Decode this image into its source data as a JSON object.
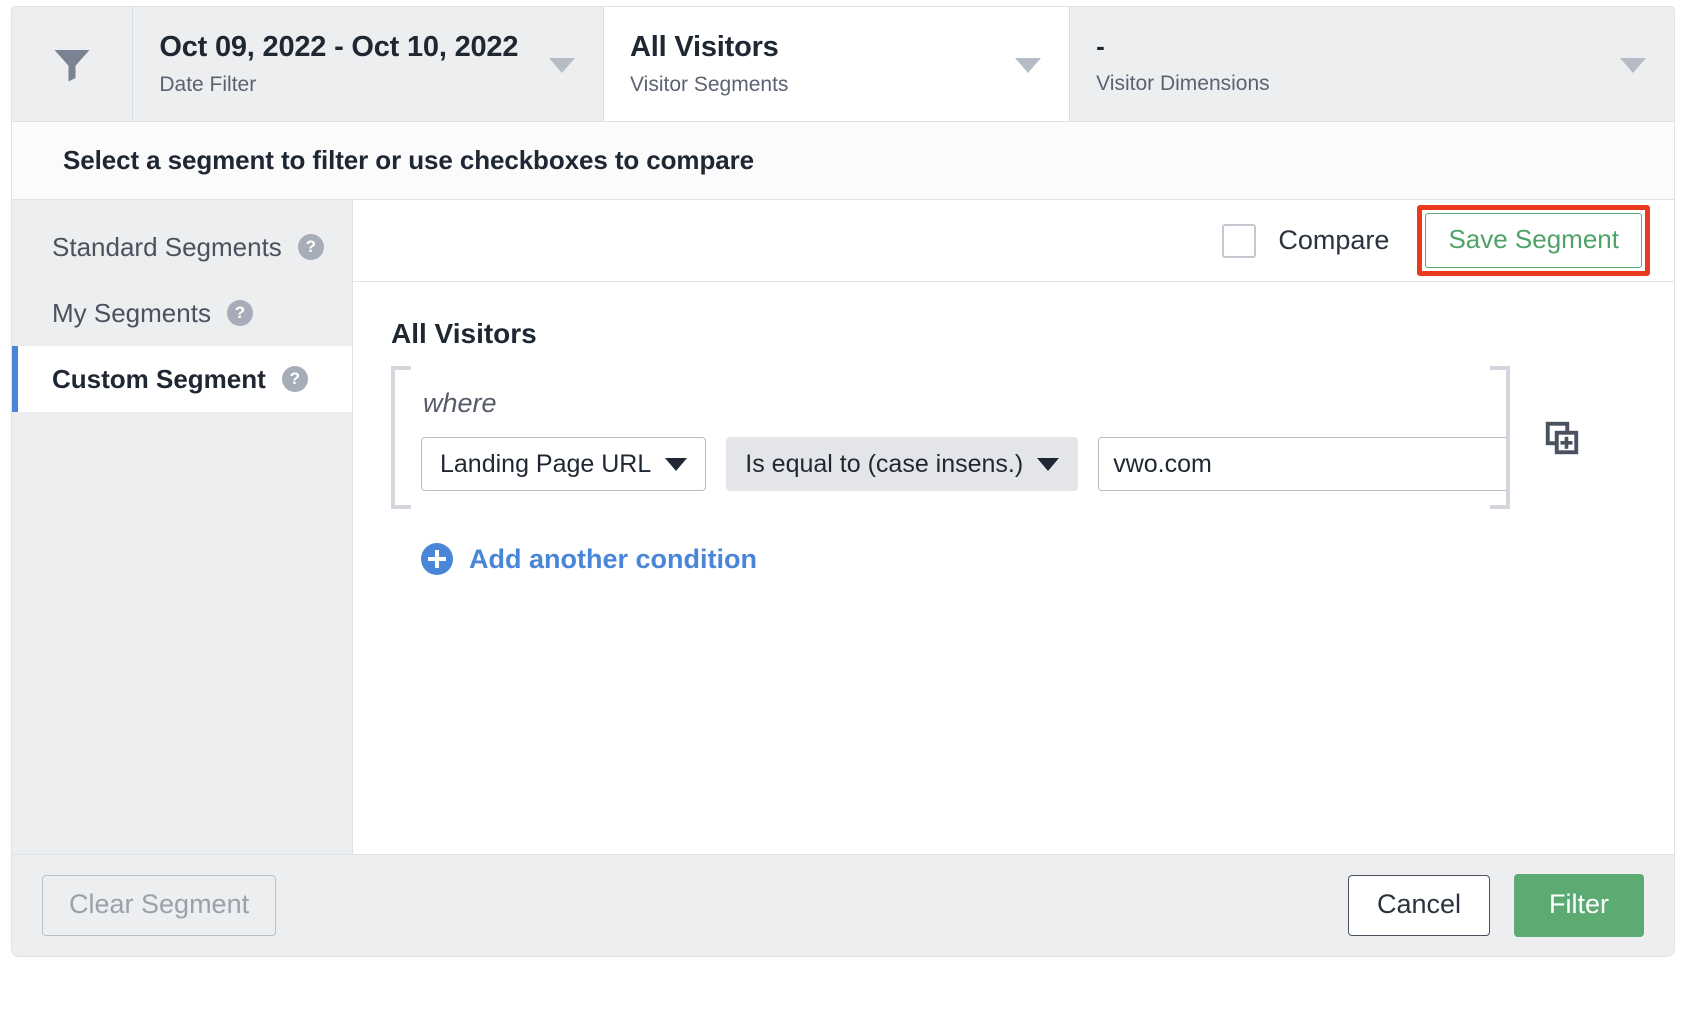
{
  "topbar": {
    "filter_icon": "funnel-icon",
    "filters": [
      {
        "value": "Oct 09, 2022 - Oct 10, 2022",
        "label": "Date Filter"
      },
      {
        "value": "All Visitors",
        "label": "Visitor Segments"
      },
      {
        "value": "-",
        "label": "Visitor Dimensions"
      }
    ]
  },
  "banner": {
    "text": "Select a segment to filter or use checkboxes to compare"
  },
  "sidebar": {
    "items": [
      {
        "label": "Standard Segments",
        "help": "?",
        "active": false
      },
      {
        "label": "My Segments",
        "help": "?",
        "active": false
      },
      {
        "label": "Custom Segment",
        "help": "?",
        "active": true
      }
    ]
  },
  "main": {
    "compare_label": "Compare",
    "compare_checked": false,
    "save_segment_label": "Save Segment",
    "segment_title": "All Visitors",
    "where_label": "where",
    "condition": {
      "dimension": "Landing Page URL",
      "operator": "Is equal to (case insens.)",
      "value": "vwo.com",
      "value_placeholder": ""
    },
    "duplicate_icon": "duplicate-icon",
    "add_condition_label": "Add another condition"
  },
  "footer": {
    "clear_label": "Clear Segment",
    "cancel_label": "Cancel",
    "filter_label": "Filter"
  },
  "colors": {
    "accent_blue": "#4a86d8",
    "green": "#5bab73",
    "save_green": "#50a368",
    "highlight_red": "#ea3a1e",
    "panel_grey": "#edeef0",
    "border_grey": "#dfe2e6"
  }
}
